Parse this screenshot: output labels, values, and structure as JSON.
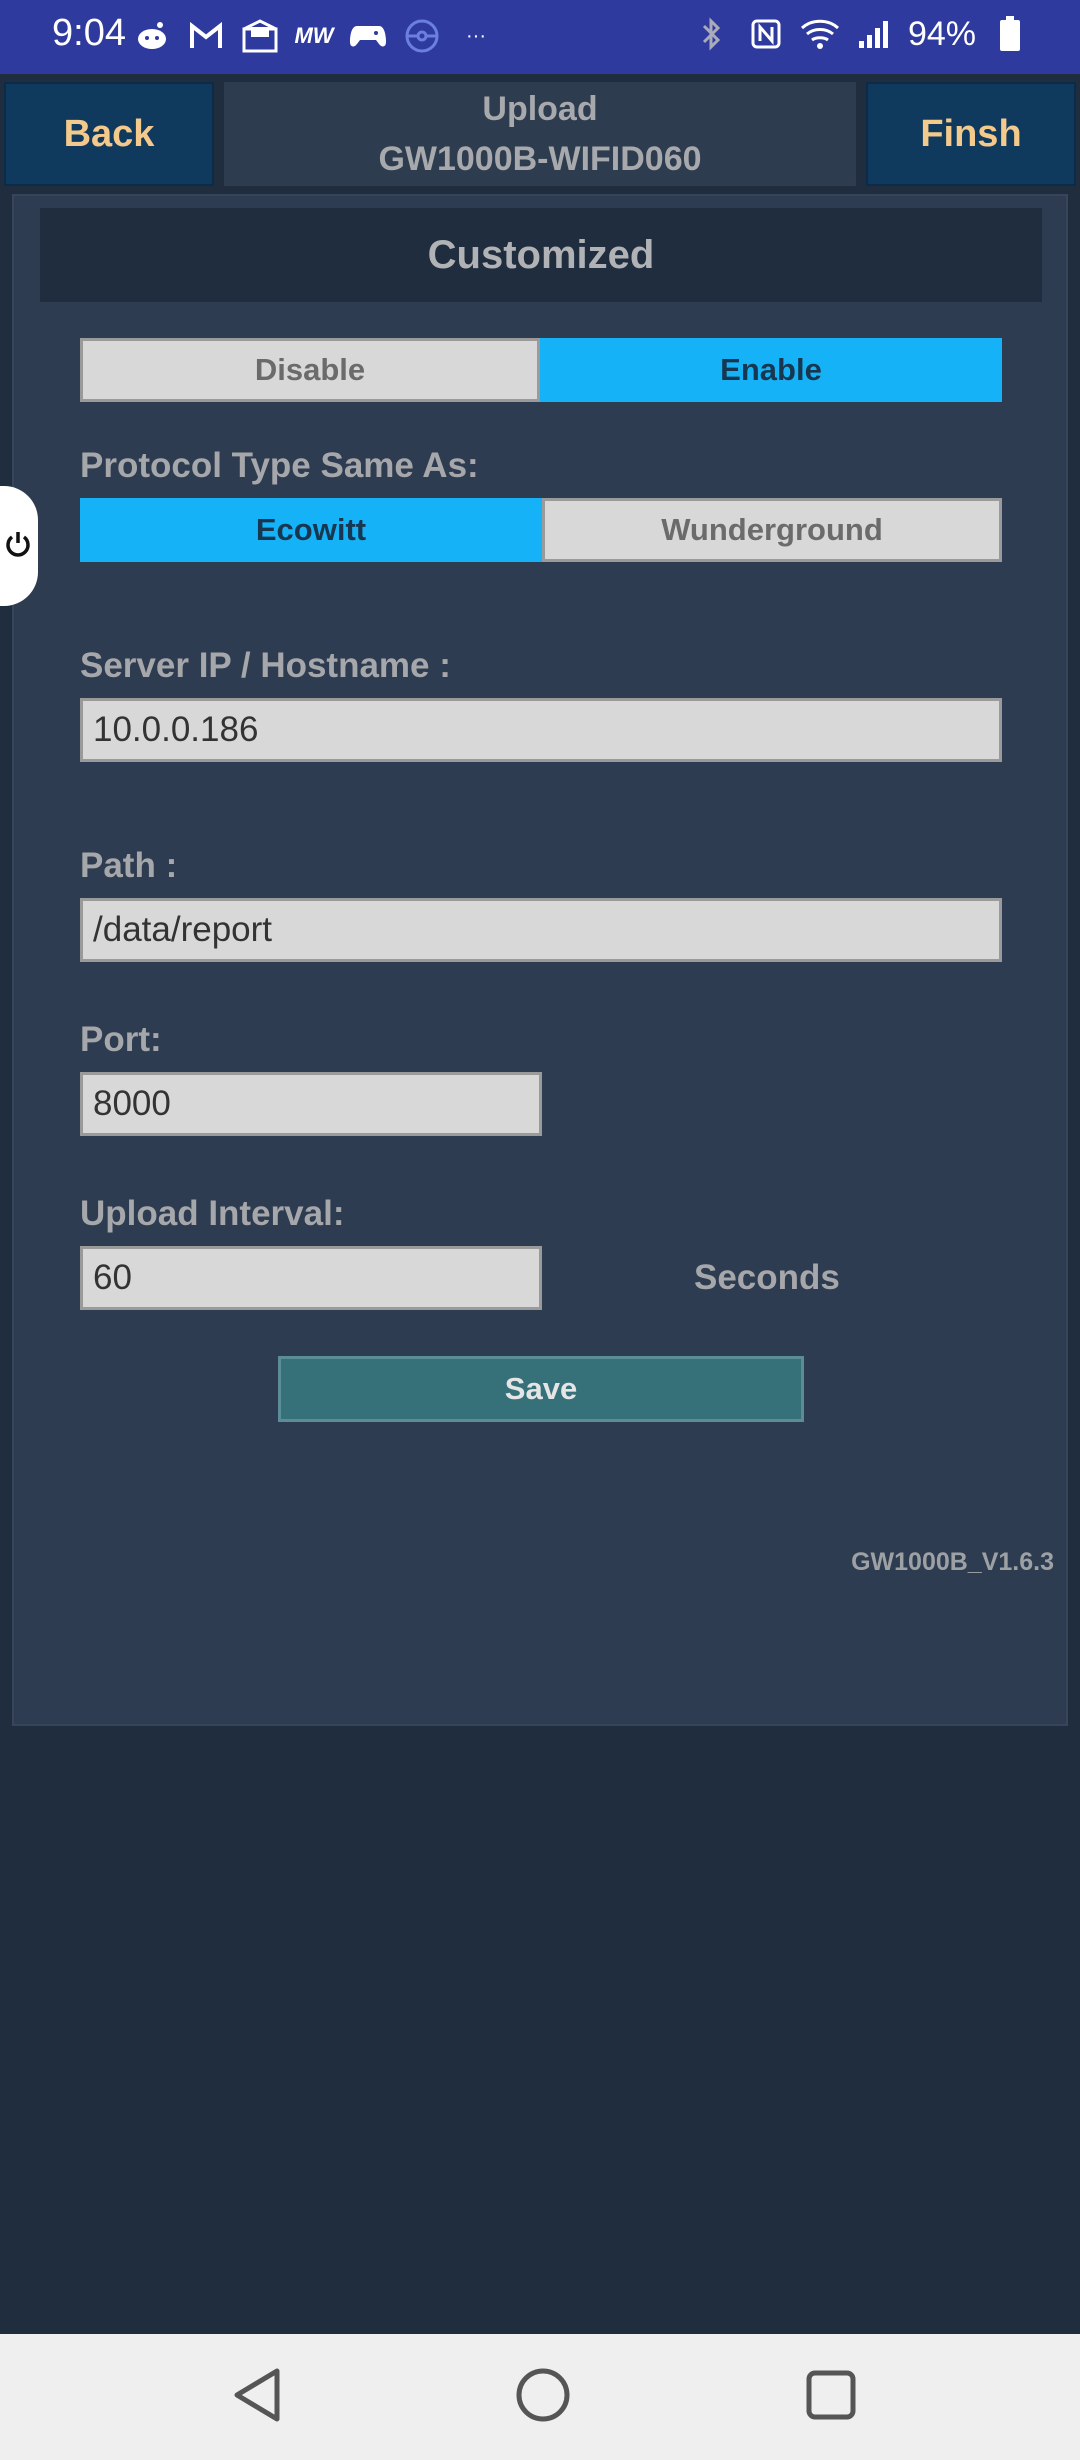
{
  "status_bar": {
    "time": "9:04",
    "battery": "94%",
    "left_icons": [
      "reddit-icon",
      "gmail-icon",
      "mail-icon",
      "mw-icon",
      "gamepad-icon",
      "pokeball-icon",
      "more-icon"
    ],
    "right_icons": [
      "bluetooth-icon",
      "nfc-icon",
      "wifi-icon",
      "signal-icon",
      "battery-icon"
    ]
  },
  "header": {
    "back_label": "Back",
    "title_line1": "Upload",
    "title_line2": "GW1000B-WIFID060",
    "finish_label": "Finsh"
  },
  "panel": {
    "section_title": "Customized",
    "toggle": {
      "disable_label": "Disable",
      "enable_label": "Enable",
      "selected": "Enable"
    },
    "protocol": {
      "label": "Protocol Type Same As:",
      "ecowitt_label": "Ecowitt",
      "wunderground_label": "Wunderground",
      "selected": "Ecowitt"
    },
    "server": {
      "label": "Server IP / Hostname :",
      "value": "10.0.0.186"
    },
    "path": {
      "label": "Path :",
      "value": "/data/report"
    },
    "port": {
      "label": "Port:",
      "value": "8000"
    },
    "interval": {
      "label": "Upload Interval:",
      "value": "60",
      "unit": "Seconds"
    },
    "save_label": "Save",
    "version": "GW1000B_V1.6.3"
  },
  "colors": {
    "accent": "#16b2f7",
    "header_button": "#10395e",
    "header_text": "#f3c98c",
    "background": "#1f2d3f"
  }
}
